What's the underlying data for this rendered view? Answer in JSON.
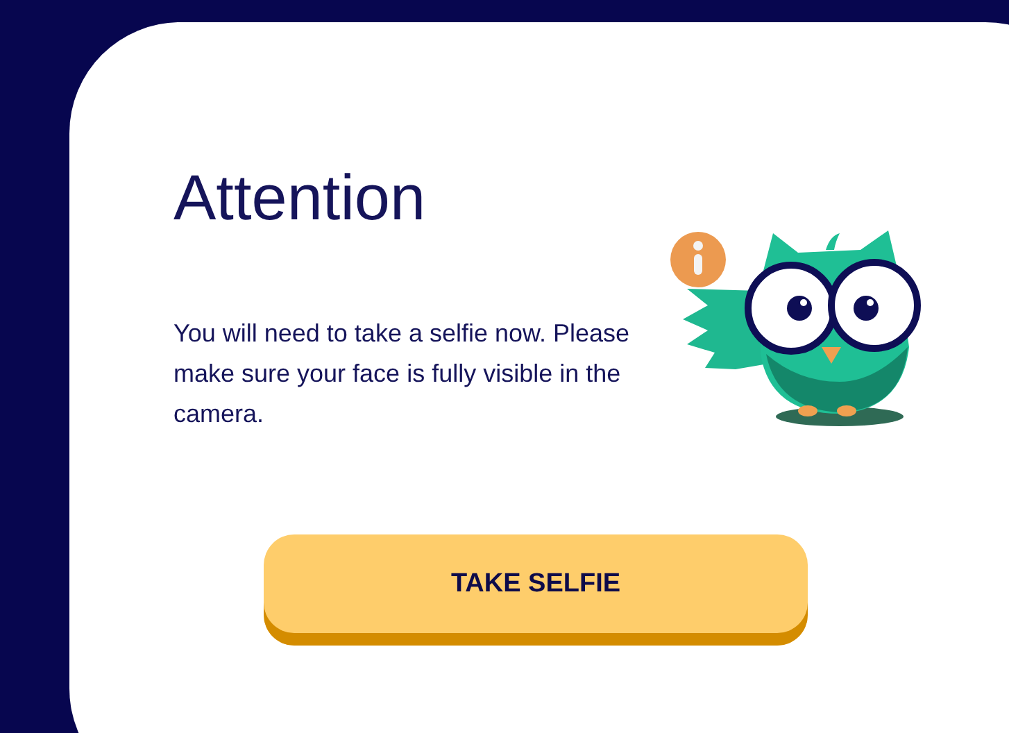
{
  "dialog": {
    "title": "Attention",
    "message": "You will need to take a selfie now. Please make sure your face is fully visible in the camera.",
    "button": {
      "label": "TAKE SELFIE"
    }
  }
}
